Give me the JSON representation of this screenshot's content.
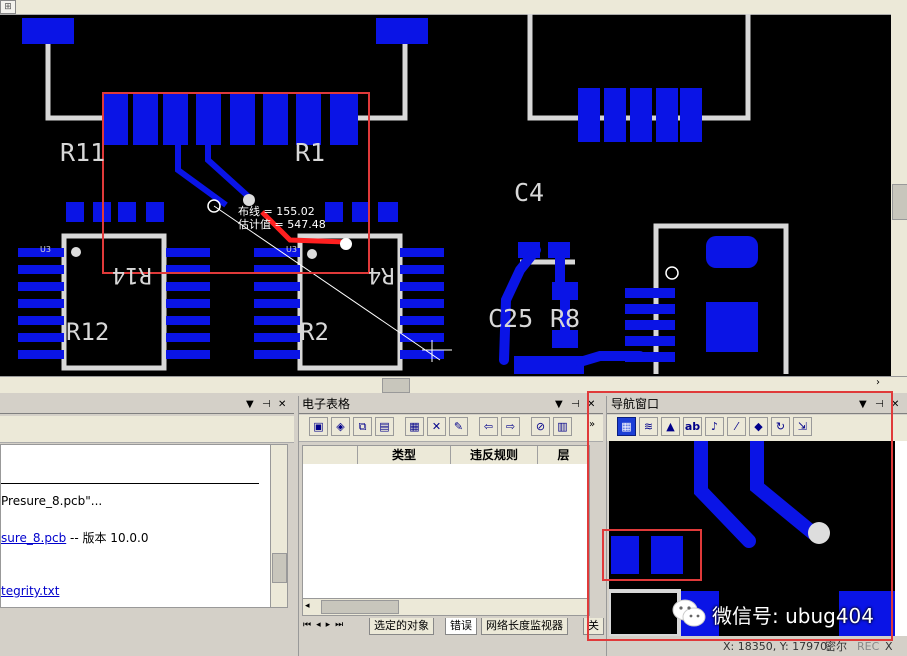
{
  "pcb": {
    "labels": {
      "r11": "R11",
      "r1": "R1",
      "c4": "C4",
      "r14": "R14",
      "r4": "R4",
      "r12": "R12",
      "r2": "R2",
      "c25": "C25",
      "r8": "R8",
      "u3a": "U3",
      "u3b": "U3"
    },
    "tooltip": {
      "line1": "布线 = 155.02",
      "line2": "估计值 = 547.48"
    },
    "colors": {
      "pad": "#0a14e6",
      "outline": "#d8d8d8",
      "highlight": "#e03a3a",
      "trace": "#ff2020"
    }
  },
  "left_panel": {
    "lines": {
      "l1": "Presure_8.pcb\"...",
      "l2_link": "sure_8.pcb",
      "l2_rest": " -- 版本  10.0.0",
      "l3_link": "tegrity.txt"
    }
  },
  "spreadsheet": {
    "title": "电子表格",
    "columns": [
      "",
      "类型",
      "违反规则",
      "层"
    ],
    "tabs": [
      "选定的对象",
      "错误",
      "网络长度监视器",
      "关"
    ]
  },
  "navigator": {
    "title": "导航窗口"
  },
  "status": {
    "coords": "X: 18350,  Y: 17970, ",
    "mode": "密尔",
    "rec": "REC",
    "x": "X"
  },
  "watermark": {
    "text": "微信号: ubug404"
  },
  "icons": [
    "grip-icon",
    "pin-icon",
    "close-icon",
    "chevron-down-icon",
    "arrow-left-icon",
    "arrow-right-icon",
    "refresh-icon",
    "wechat-icon"
  ]
}
